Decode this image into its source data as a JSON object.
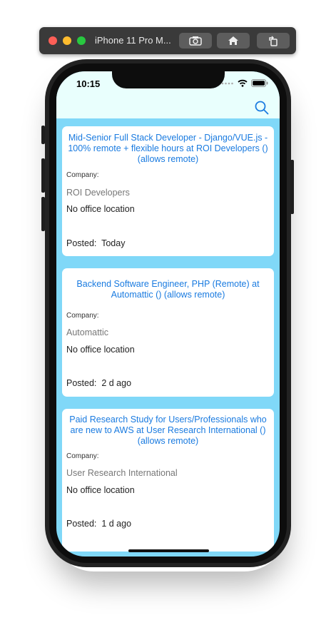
{
  "simulator": {
    "title": "iPhone 11 Pro M...",
    "buttons": [
      "screenshot-icon",
      "home-icon",
      "rotate-icon"
    ]
  },
  "status_bar": {
    "time": "10:15"
  },
  "header": {
    "search_icon": "search-icon",
    "accent": "#1a7be0",
    "background": "#e9fffd"
  },
  "jobs": [
    {
      "title": "Mid-Senior Full Stack Developer - Django/VUE.js - 100% remote + flexible hours at ROI Developers () (allows remote)",
      "company_label": "Company:",
      "company": "ROI Developers",
      "location": "No office location",
      "posted": "Posted:  Today"
    },
    {
      "title": "Backend Software Engineer, PHP (Remote) at Automattic () (allows remote)",
      "company_label": "Company:",
      "company": "Automattic",
      "location": "No office location",
      "posted": "Posted:  2 d ago"
    },
    {
      "title": "Paid Research Study for Users/Professionals who are new to AWS at User Research International () (allows remote)",
      "company_label": "Company:",
      "company": "User Research International",
      "location": "No office location",
      "posted": "Posted:  1 d ago"
    }
  ],
  "colors": {
    "list_background": "#80d8f8",
    "card_background": "#ffffff",
    "title_link": "#1a7be0"
  }
}
